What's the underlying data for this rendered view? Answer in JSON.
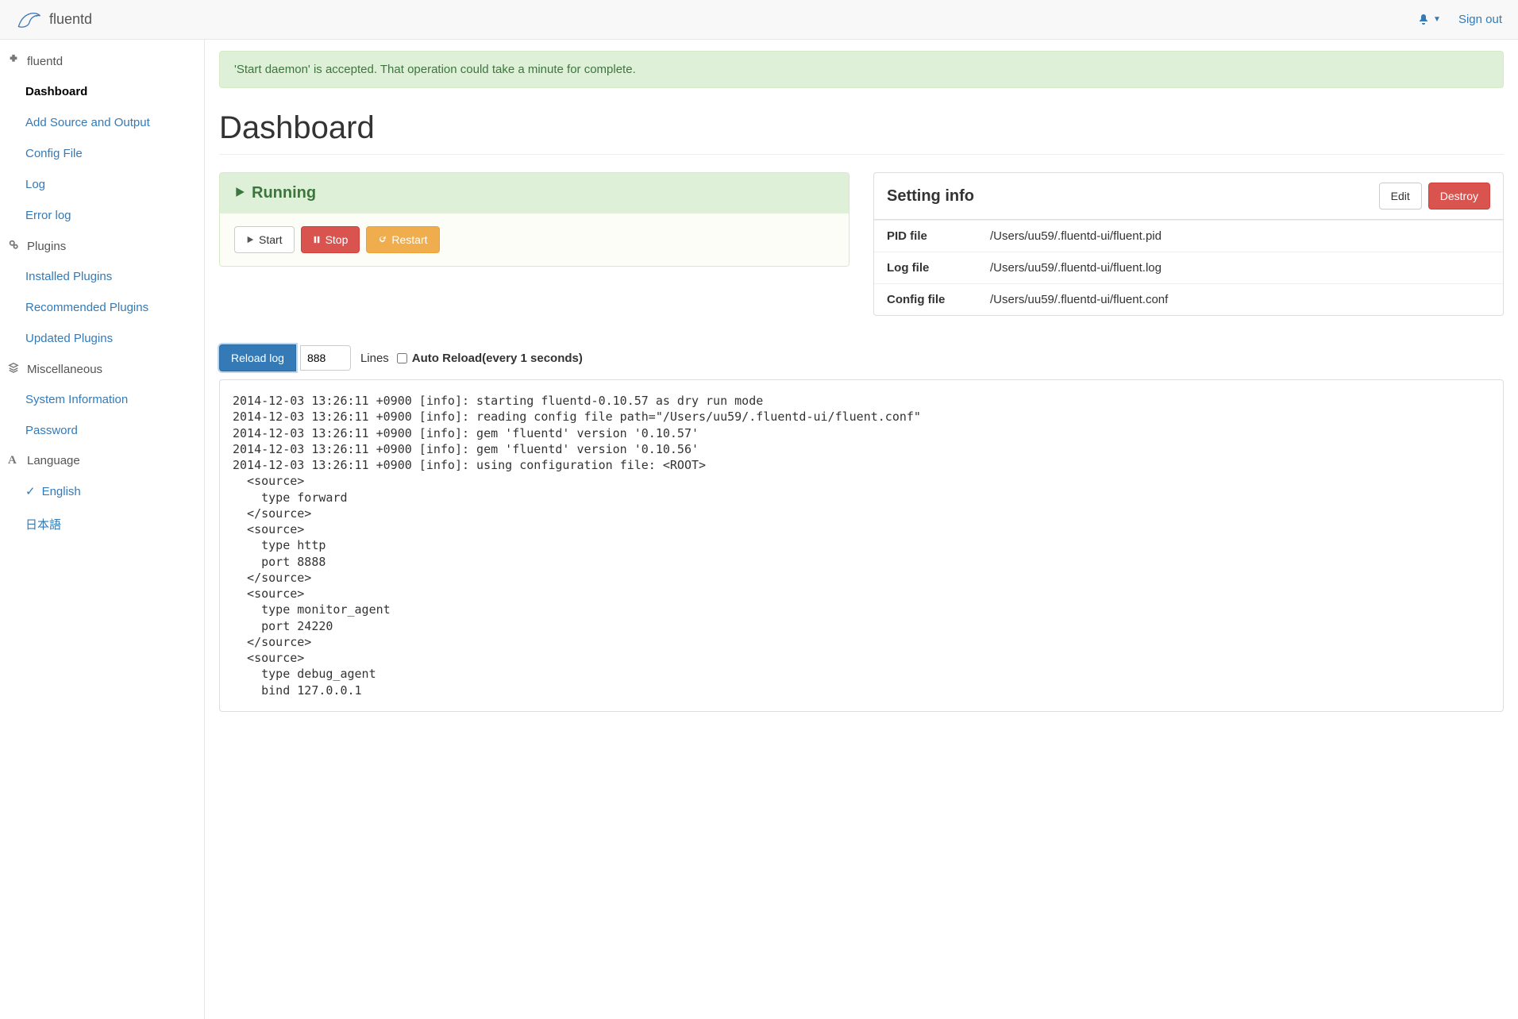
{
  "topbar": {
    "brand": "fluentd",
    "signout": "Sign out"
  },
  "sidebar": {
    "sec_fluentd": {
      "label": "fluentd"
    },
    "items_fluentd": [
      {
        "id": "dashboard",
        "label": "Dashboard",
        "active": true
      },
      {
        "id": "add-source-output",
        "label": "Add Source and Output"
      },
      {
        "id": "config-file",
        "label": "Config File"
      },
      {
        "id": "log",
        "label": "Log"
      },
      {
        "id": "error-log",
        "label": "Error log"
      }
    ],
    "sec_plugins": {
      "label": "Plugins"
    },
    "items_plugins": [
      {
        "id": "installed-plugins",
        "label": "Installed Plugins"
      },
      {
        "id": "recommended-plugins",
        "label": "Recommended Plugins"
      },
      {
        "id": "updated-plugins",
        "label": "Updated Plugins"
      }
    ],
    "sec_misc": {
      "label": "Miscellaneous"
    },
    "items_misc": [
      {
        "id": "system-information",
        "label": "System Information"
      },
      {
        "id": "password",
        "label": "Password"
      }
    ],
    "sec_lang": {
      "label": "Language"
    },
    "items_lang": [
      {
        "id": "english",
        "label": "English",
        "checked": true
      },
      {
        "id": "japanese",
        "label": "日本語"
      }
    ]
  },
  "alert": {
    "message": "'Start daemon' is accepted. That operation could take a minute for complete."
  },
  "page": {
    "title": "Dashboard"
  },
  "status": {
    "label": "Running",
    "start": "Start",
    "stop": "Stop",
    "restart": "Restart"
  },
  "setting": {
    "title": "Setting info",
    "edit": "Edit",
    "destroy": "Destroy",
    "rows": {
      "pid_label": "PID file",
      "pid_value": "/Users/uu59/.fluentd-ui/fluent.pid",
      "log_label": "Log file",
      "log_value": "/Users/uu59/.fluentd-ui/fluent.log",
      "conf_label": "Config file",
      "conf_value": "/Users/uu59/.fluentd-ui/fluent.conf"
    }
  },
  "logcontrols": {
    "reload": "Reload log",
    "lines_value": "888",
    "lines_label": "Lines",
    "auto_label": "Auto Reload(every 1 seconds)"
  },
  "log_text": "2014-12-03 13:26:11 +0900 [info]: starting fluentd-0.10.57 as dry run mode\n2014-12-03 13:26:11 +0900 [info]: reading config file path=\"/Users/uu59/.fluentd-ui/fluent.conf\"\n2014-12-03 13:26:11 +0900 [info]: gem 'fluentd' version '0.10.57'\n2014-12-03 13:26:11 +0900 [info]: gem 'fluentd' version '0.10.56'\n2014-12-03 13:26:11 +0900 [info]: using configuration file: <ROOT>\n  <source>\n    type forward\n  </source>\n  <source>\n    type http\n    port 8888\n  </source>\n  <source>\n    type monitor_agent\n    port 24220\n  </source>\n  <source>\n    type debug_agent\n    bind 127.0.0.1"
}
